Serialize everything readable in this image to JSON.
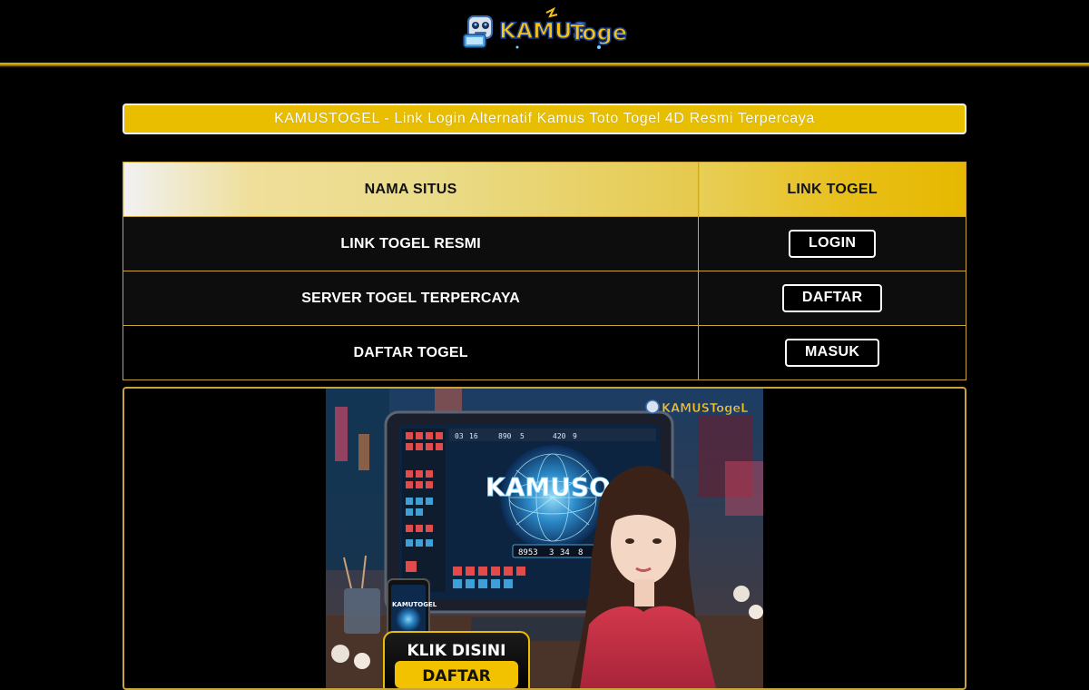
{
  "header": {
    "logo_text_main": "KAMUS",
    "logo_text_sub": "Togel"
  },
  "headline": {
    "text": "KAMUSTOGEL - Link Login Alternatif Kamus Toto Togel 4D Resmi Terpercaya"
  },
  "table": {
    "headers": [
      "NAMA SITUS",
      "LINK TOGEL"
    ],
    "rows": [
      {
        "name": "LINK TOGEL RESMI",
        "button": "LOGIN"
      },
      {
        "name": "SERVER TOGEL TERPERCAYA",
        "button": "DAFTAR"
      },
      {
        "name": "DAFTAR TOGEL",
        "button": "MASUK"
      }
    ]
  },
  "banner": {
    "screen_text": "KAMUSOGEL",
    "phone_text": "KAMUTOGEL",
    "cta_line1": "KLIK DISINI",
    "cta_line2": "DAFTAR",
    "logo_text": "KAMUSTogeL",
    "ticker": [
      "03",
      "16",
      "890",
      "5",
      "420",
      "9"
    ],
    "readout": [
      "8953",
      "3",
      "34",
      "8"
    ]
  },
  "colors": {
    "accent_gold": "#e9bd00",
    "border_gold": "#c9a43b",
    "background": "#000000"
  }
}
